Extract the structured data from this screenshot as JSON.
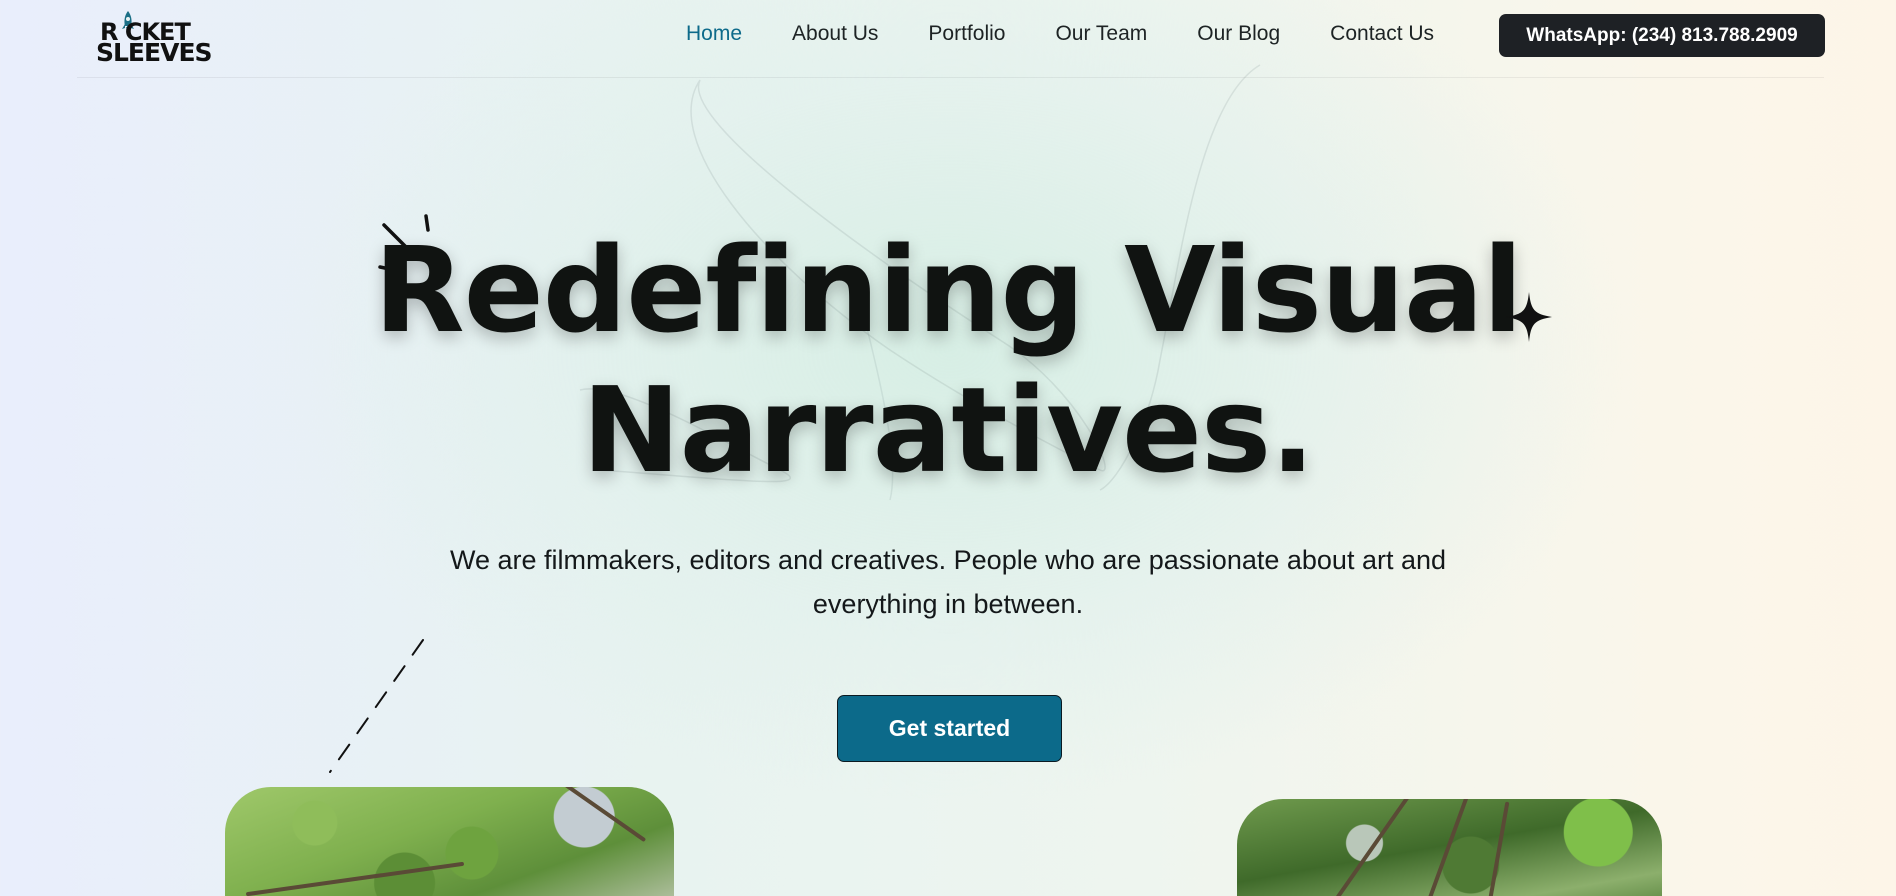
{
  "brand": {
    "logo_line1": "R CKET",
    "logo_line2": "SLEEVES"
  },
  "nav": {
    "items": [
      {
        "label": "Home",
        "active": true
      },
      {
        "label": "About Us",
        "active": false
      },
      {
        "label": "Portfolio",
        "active": false
      },
      {
        "label": "Our Team",
        "active": false
      },
      {
        "label": "Our Blog",
        "active": false
      },
      {
        "label": "Contact Us",
        "active": false
      }
    ],
    "whatsapp_label": "WhatsApp: (234) 813.788.2909"
  },
  "hero": {
    "title_line1": "Redefining Visual",
    "title_line2": "Narratives.",
    "subtitle": "We are filmmakers, editors and creatives. People who are passionate about art and everything in between.",
    "cta_label": "Get started"
  },
  "colors": {
    "accent": "#0c6a8a",
    "active_nav": "#0d6a8a",
    "dark_button": "#1e2125",
    "text": "#111314"
  },
  "icons": [
    "rocket-icon",
    "sparkle-lines-icon",
    "four-point-star-icon",
    "dashed-line-decoration"
  ]
}
